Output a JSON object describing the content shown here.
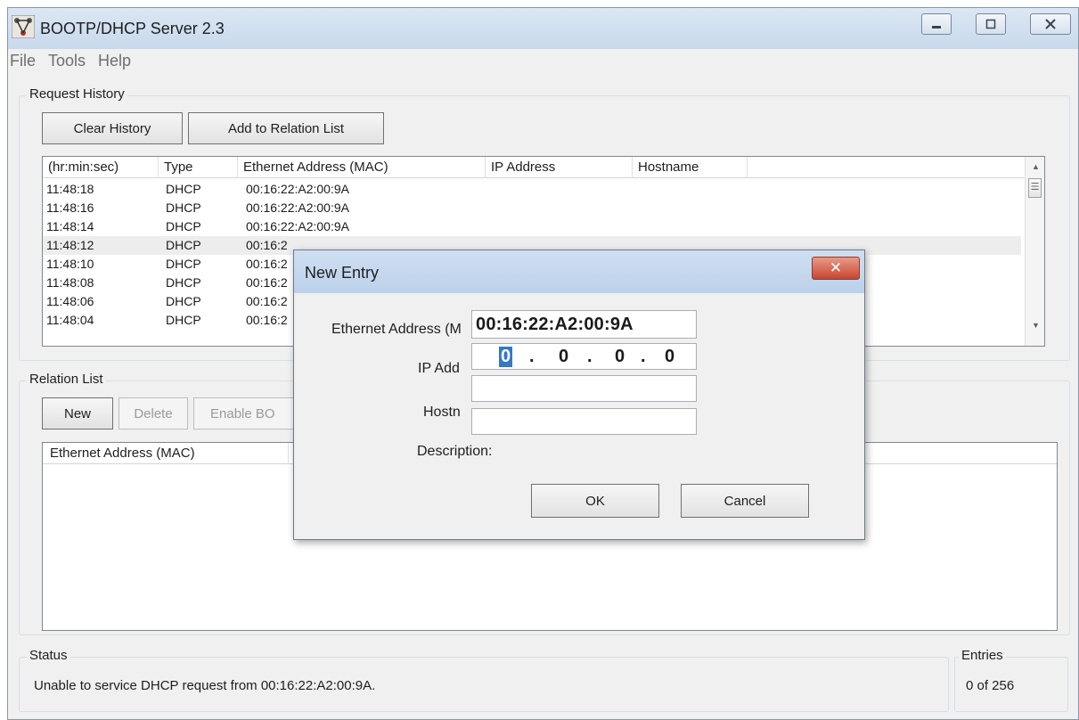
{
  "window": {
    "title": "BOOTP/DHCP Server 2.3",
    "icon": "network-tree-icon"
  },
  "menu": [
    "File",
    "Tools",
    "Help"
  ],
  "request_history": {
    "label": "Request History",
    "clear_button": "Clear History",
    "add_button": "Add to Relation List",
    "columns": [
      "(hr:min:sec)",
      "Type",
      "Ethernet Address (MAC)",
      "IP Address",
      "Hostname"
    ],
    "rows": [
      {
        "time": "11:48:18",
        "type": "DHCP",
        "mac": "00:16:22:A2:00:9A"
      },
      {
        "time": "11:48:16",
        "type": "DHCP",
        "mac": "00:16:22:A2:00:9A"
      },
      {
        "time": "11:48:14",
        "type": "DHCP",
        "mac": "00:16:22:A2:00:9A"
      },
      {
        "time": "11:48:12",
        "type": "DHCP",
        "mac": "00:16:2"
      },
      {
        "time": "11:48:10",
        "type": "DHCP",
        "mac": "00:16:2"
      },
      {
        "time": "11:48:08",
        "type": "DHCP",
        "mac": "00:16:2"
      },
      {
        "time": "11:48:06",
        "type": "DHCP",
        "mac": "00:16:2"
      },
      {
        "time": "11:48:04",
        "type": "DHCP",
        "mac": "00:16:2"
      }
    ]
  },
  "relation_list": {
    "label": "Relation List",
    "new_button": "New",
    "delete_button": "Delete",
    "enable_button": "Enable BO",
    "columns": [
      "Ethernet Address (MAC)"
    ]
  },
  "status": {
    "label": "Status",
    "text": "Unable to service DHCP request from 00:16:22:A2:00:9A."
  },
  "entries": {
    "label": "Entries",
    "value": "0 of 256"
  },
  "dialog": {
    "title": "New Entry",
    "close_glyph": "✕",
    "mac_label": "Ethernet Address (M",
    "mac_value": "00:16:22:A2:00:9A",
    "ip_label": "IP Add",
    "ip_segments": [
      "0",
      "0",
      "0",
      "0"
    ],
    "hostname_label": "Hostn",
    "description_label": "Description:",
    "ok_button": "OK",
    "cancel_button": "Cancel"
  }
}
